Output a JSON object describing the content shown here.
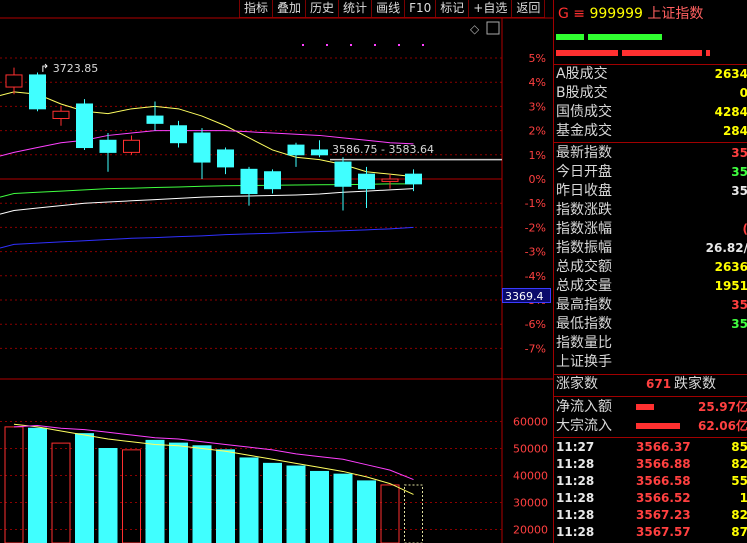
{
  "toolbar": [
    "指标",
    "叠加",
    "历史",
    "统计",
    "画线",
    "F10",
    "标记",
    "+自选",
    "返回"
  ],
  "colors": {
    "up": "#ff3030",
    "down": "#40ffff",
    "grid": "#8a0000",
    "axis": "#ff4040"
  },
  "chart": {
    "price_axis_labels": [
      "5%",
      "4%",
      "3%",
      "2%",
      "1%",
      "0%",
      "-1%",
      "-2%",
      "-3%",
      "-4%",
      "-5%",
      "-6%",
      "-7%"
    ],
    "volume_axis_labels": [
      "60000",
      "50000",
      "40000",
      "30000",
      "20000"
    ],
    "high_annotation": "3723.85",
    "range_annotation": "3586.75 - 3583.64",
    "price_tag": "3369.4"
  },
  "chart_data": {
    "type": "candlestick",
    "price_pct_range": [
      -7,
      5
    ],
    "candles": [
      {
        "o": 3.8,
        "c": 4.3,
        "h": 4.6,
        "l": 3.5
      },
      {
        "o": 4.3,
        "c": 2.9,
        "h": 4.4,
        "l": 2.8
      },
      {
        "o": 2.5,
        "c": 2.8,
        "h": 3.0,
        "l": 2.2
      },
      {
        "o": 3.1,
        "c": 1.3,
        "h": 3.3,
        "l": 1.2
      },
      {
        "o": 1.6,
        "c": 1.1,
        "h": 1.9,
        "l": 0.3
      },
      {
        "o": 1.1,
        "c": 1.6,
        "h": 1.8,
        "l": 1.0
      },
      {
        "o": 2.6,
        "c": 2.3,
        "h": 3.2,
        "l": 2.0
      },
      {
        "o": 2.2,
        "c": 1.5,
        "h": 2.4,
        "l": 1.3
      },
      {
        "o": 1.9,
        "c": 0.7,
        "h": 2.1,
        "l": 0.0
      },
      {
        "o": 1.2,
        "c": 0.5,
        "h": 1.3,
        "l": 0.2
      },
      {
        "o": 0.4,
        "c": -0.6,
        "h": 0.5,
        "l": -1.1
      },
      {
        "o": 0.3,
        "c": -0.4,
        "h": 0.4,
        "l": -0.6
      },
      {
        "o": 1.4,
        "c": 1.0,
        "h": 1.5,
        "l": 0.5
      },
      {
        "o": 1.2,
        "c": 1.0,
        "h": 1.6,
        "l": 0.9
      },
      {
        "o": 0.7,
        "c": -0.3,
        "h": 0.9,
        "l": -1.3
      },
      {
        "o": 0.2,
        "c": -0.4,
        "h": 0.5,
        "l": -1.2
      },
      {
        "o": -0.1,
        "c": 0.0,
        "h": 0.2,
        "l": -0.4
      },
      {
        "o": 0.2,
        "c": -0.2,
        "h": 0.4,
        "l": -0.5
      }
    ],
    "volume_range": [
      15000,
      65000
    ],
    "volumes": [
      58000,
      57500,
      52000,
      55500,
      50000,
      49500,
      53000,
      52000,
      51000,
      49500,
      46500,
      44500,
      43500,
      41500,
      40500,
      38000,
      36500,
      36500
    ],
    "ma_lines": [
      {
        "color": "#ffff60",
        "pct": [
          3.6,
          3.5,
          3.1,
          2.8,
          2.7,
          2.9,
          3.0,
          2.9,
          2.6,
          2.2,
          1.7,
          1.2,
          0.9,
          0.8,
          0.6,
          0.3,
          0.2,
          0.1
        ]
      },
      {
        "color": "#ff40ff",
        "pct": [
          1.1,
          1.3,
          1.5,
          1.6,
          1.8,
          1.9,
          2.0,
          2.0,
          2.0,
          2.0,
          1.95,
          1.9,
          1.85,
          1.8,
          1.7,
          1.6,
          1.5,
          1.45
        ]
      },
      {
        "color": "#40ff40",
        "pct": [
          -0.6,
          -0.55,
          -0.5,
          -0.45,
          -0.4,
          -0.38,
          -0.35,
          -0.33,
          -0.3,
          -0.28,
          -0.27,
          -0.26,
          -0.25,
          -0.24,
          -0.23,
          -0.22,
          -0.2,
          -0.2
        ]
      },
      {
        "color": "#ffffff",
        "pct": [
          -1.3,
          -1.2,
          -1.1,
          -1.0,
          -0.95,
          -0.9,
          -0.85,
          -0.8,
          -0.75,
          -0.72,
          -0.7,
          -0.68,
          -0.66,
          -0.62,
          -0.55,
          -0.5,
          -0.45,
          -0.4
        ]
      },
      {
        "color": "#3030ff",
        "pct": [
          -2.7,
          -2.65,
          -2.6,
          -2.55,
          -2.5,
          -2.45,
          -2.42,
          -2.38,
          -2.35,
          -2.3,
          -2.27,
          -2.24,
          -2.2,
          -2.17,
          -2.14,
          -2.1,
          -2.06,
          -2.0
        ]
      }
    ],
    "vol_ma_lines": [
      {
        "color": "#ffff60",
        "v": [
          59000,
          58000,
          56500,
          55000,
          53500,
          52500,
          51500,
          51000,
          50000,
          49000,
          47500,
          46000,
          44500,
          43000,
          41500,
          39500,
          37000,
          33000
        ]
      },
      {
        "color": "#ff40ff",
        "v": [
          58000,
          58500,
          57500,
          57000,
          56000,
          55000,
          54000,
          53500,
          52500,
          51500,
          50500,
          49500,
          48000,
          47000,
          46000,
          44000,
          42000,
          38500
        ]
      }
    ]
  },
  "panel": {
    "title_prefix": "G ≡",
    "code": "999999",
    "name": "上证指数",
    "stats": [
      {
        "label": "A股成交",
        "value": "2634",
        "color": "#ffff00"
      },
      {
        "label": "B股成交",
        "value": "0",
        "color": "#ffff00"
      },
      {
        "label": "国债成交",
        "value": "4284",
        "color": "#ffff00"
      },
      {
        "label": "基金成交",
        "value": "284",
        "color": "#ffff00"
      }
    ],
    "quotes": [
      {
        "label": "最新指数",
        "value": "35",
        "color": "#ff4040"
      },
      {
        "label": "今日开盘",
        "value": "35",
        "color": "#40ff40"
      },
      {
        "label": "昨日收盘",
        "value": "35",
        "color": "#e8e8e8"
      },
      {
        "label": "指数涨跌",
        "value": "",
        "color": "#ff4040"
      },
      {
        "label": "指数涨幅",
        "value": "(",
        "color": "#ff4040"
      },
      {
        "label": "指数振幅",
        "value": "26.82/",
        "color": "#e8e8e8"
      },
      {
        "label": "总成交额",
        "value": "2636",
        "color": "#ffff00"
      },
      {
        "label": "总成交量",
        "value": "1951",
        "color": "#ffff00"
      },
      {
        "label": "最高指数",
        "value": "35",
        "color": "#ff4040"
      },
      {
        "label": "最低指数",
        "value": "35",
        "color": "#40ff40"
      },
      {
        "label": "指数量比",
        "value": "",
        "color": "#e8e8e8"
      },
      {
        "label": "上证换手",
        "value": "",
        "color": "#e8e8e8"
      }
    ],
    "breadth": {
      "up_label": "涨家数",
      "up_value": "671",
      "down_label": "跌家数"
    },
    "flows": [
      {
        "label": "净流入额",
        "value": "25.97亿"
      },
      {
        "label": "大宗流入",
        "value": "62.06亿"
      }
    ],
    "ticks": [
      {
        "time": "11:27",
        "price": "3566.37",
        "vol": "85"
      },
      {
        "time": "11:28",
        "price": "3566.88",
        "vol": "82"
      },
      {
        "time": "11:28",
        "price": "3566.58",
        "vol": "55"
      },
      {
        "time": "11:28",
        "price": "3566.52",
        "vol": "1"
      },
      {
        "time": "11:28",
        "price": "3567.23",
        "vol": "82"
      },
      {
        "time": "11:28",
        "price": "3567.57",
        "vol": "87"
      }
    ]
  }
}
